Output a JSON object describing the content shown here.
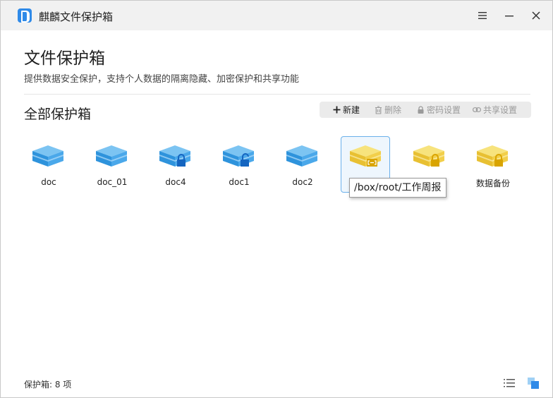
{
  "app": {
    "title": "麒麟文件保护箱"
  },
  "header": {
    "title": "文件保护箱",
    "subtitle": "提供数据安全保护，支持个人数据的隔离隐藏、加密保护和共享功能"
  },
  "section": {
    "title": "全部保护箱"
  },
  "toolbar": {
    "new_label": "新建",
    "delete_label": "删除",
    "password_label": "密码设置",
    "share_label": "共享设置"
  },
  "boxes": [
    {
      "label": "doc",
      "color": "blue",
      "icon": "box-icon",
      "locked": false
    },
    {
      "label": "doc_01",
      "color": "blue",
      "icon": "box-icon",
      "locked": false
    },
    {
      "label": "doc4",
      "color": "blue",
      "icon": "box-locked-icon",
      "locked": true
    },
    {
      "label": "doc1",
      "color": "blue",
      "icon": "box-unlocked-icon",
      "locked": false
    },
    {
      "label": "doc2",
      "color": "blue",
      "icon": "box-icon",
      "locked": false
    },
    {
      "label": "",
      "color": "yellow",
      "icon": "shared-box-icon",
      "locked": false,
      "selected": true
    },
    {
      "label": "",
      "color": "yellow",
      "icon": "box-locked-icon",
      "locked": true
    },
    {
      "label": "数据备份",
      "color": "yellow",
      "icon": "box-locked-icon",
      "locked": true
    }
  ],
  "tooltip": {
    "text": "/box/root/工作周报"
  },
  "status": {
    "text": "保护箱: 8 项"
  },
  "colors": {
    "blue_box": "#3a9fe0",
    "yellow_box": "#f2cf4a",
    "lock_blue": "#1565c0",
    "lock_yellow": "#d9a400",
    "accent": "#2f8ae8"
  }
}
